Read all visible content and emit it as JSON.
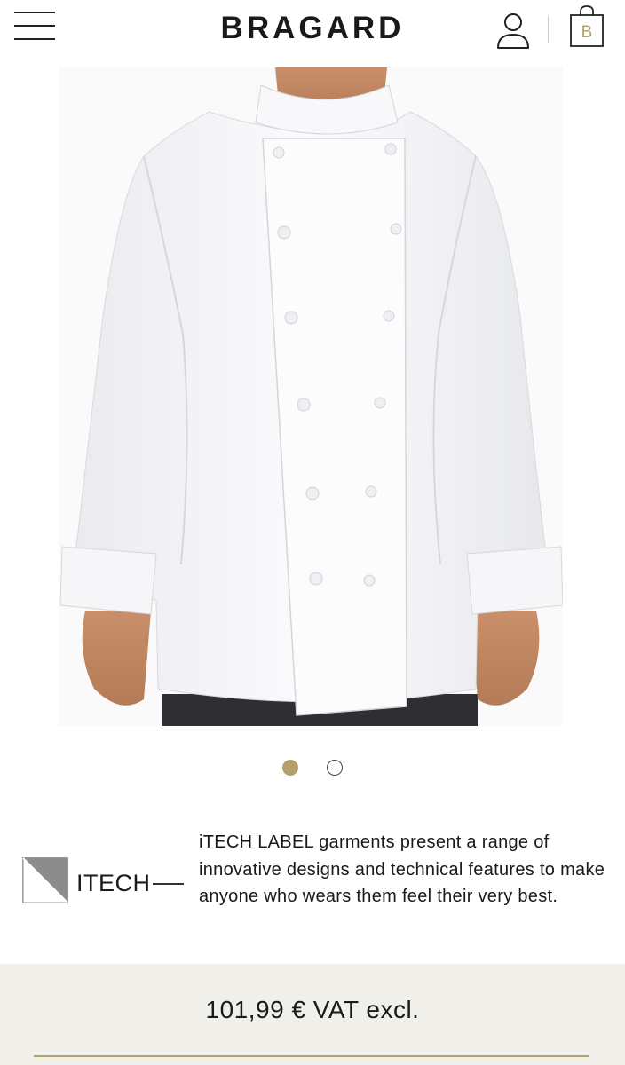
{
  "header": {
    "brand": "BRAGARD",
    "cart_badge": "B"
  },
  "icons": {
    "menu": "hamburger-menu-icon",
    "user": "user-account-icon",
    "cart": "shopping-bag-icon",
    "itech": "itech-label-logo"
  },
  "product": {
    "image_description": "white chef jacket",
    "carousel": {
      "total": 2,
      "active_index": 0
    }
  },
  "itech": {
    "label": "ITECH",
    "description": "iTECH LABEL garments present a range of innovative designs and technical features to make anyone who wears them feel their very best."
  },
  "price": {
    "text": "101,99 € VAT excl."
  },
  "colors": {
    "accent_gold": "#b3a06a",
    "price_background": "#f0efe9",
    "text": "#1a1a1a",
    "itech_gray": "#8c8c8c"
  }
}
